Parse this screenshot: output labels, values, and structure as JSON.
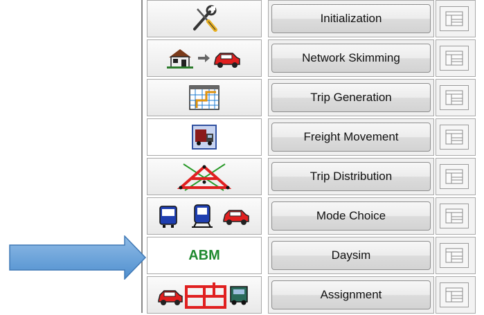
{
  "steps": [
    {
      "label": "Initialization",
      "icon": "tools-icon"
    },
    {
      "label": "Network Skimming",
      "icon": "house-to-car-icon"
    },
    {
      "label": "Trip Generation",
      "icon": "matrix-chart-icon"
    },
    {
      "label": "Freight Movement",
      "icon": "truck-icon"
    },
    {
      "label": "Trip Distribution",
      "icon": "distribution-network-icon"
    },
    {
      "label": "Mode Choice",
      "icon": "bus-train-car-icon"
    },
    {
      "label": "Daysim",
      "icon_text": "ABM"
    },
    {
      "label": "Assignment",
      "icon": "car-network-truck-icon"
    }
  ],
  "colors": {
    "arrow_fill": "#5b9bd5",
    "abm_text": "#1f8a2f",
    "icon_red": "#e02020",
    "icon_blue": "#1f3fb0"
  }
}
